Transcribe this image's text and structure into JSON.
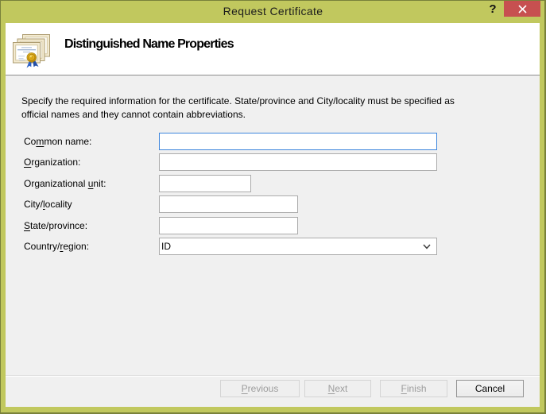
{
  "window": {
    "title": "Request Certificate",
    "frame_color": "#C1C85E",
    "close_color": "#C75050",
    "help_glyph": "?"
  },
  "header": {
    "title": "Distinguished Name Properties",
    "icon": "certificates-icon"
  },
  "main": {
    "description_line1": "Specify the required information for the certificate. State/province and City/locality must be specified as",
    "description_line2": "official names and they cannot contain abbreviations.",
    "fields": [
      {
        "label_pre": "Co",
        "label_key": "m",
        "label_post": "mon name:",
        "value": "",
        "type": "text",
        "focused": true
      },
      {
        "label_pre": "",
        "label_key": "O",
        "label_post": "rganization:",
        "value": "",
        "type": "text"
      },
      {
        "label_pre": "Organizational ",
        "label_key": "u",
        "label_post": "nit:",
        "value": "",
        "type": "text"
      },
      {
        "label_pre": "City/",
        "label_key": "l",
        "label_post": "ocality",
        "value": "",
        "type": "text"
      },
      {
        "label_pre": "",
        "label_key": "S",
        "label_post": "tate/province:",
        "value": "",
        "type": "text"
      },
      {
        "label_pre": "Country/",
        "label_key": "r",
        "label_post": "egion:",
        "value": "ID",
        "type": "combobox"
      }
    ]
  },
  "footer": {
    "buttons": [
      {
        "label_pre": "",
        "label_key": "P",
        "label_post": "revious",
        "enabled": false
      },
      {
        "label_pre": "",
        "label_key": "N",
        "label_post": "ext",
        "enabled": false
      },
      {
        "label_pre": "",
        "label_key": "F",
        "label_post": "inish",
        "enabled": false
      },
      {
        "label_pre": "Cancel",
        "label_key": "",
        "label_post": "",
        "enabled": true
      }
    ]
  },
  "colors": {
    "titlebar": "#C1C85E",
    "frame_edge": "#79813A",
    "content_bg": "#F0F0F0",
    "header_bg": "#FFFFFF",
    "input_border": "#ABABAB",
    "input_focus_border": "#3E86DD",
    "close_button": "#C75050",
    "disabled_text": "#9D9D9D"
  }
}
